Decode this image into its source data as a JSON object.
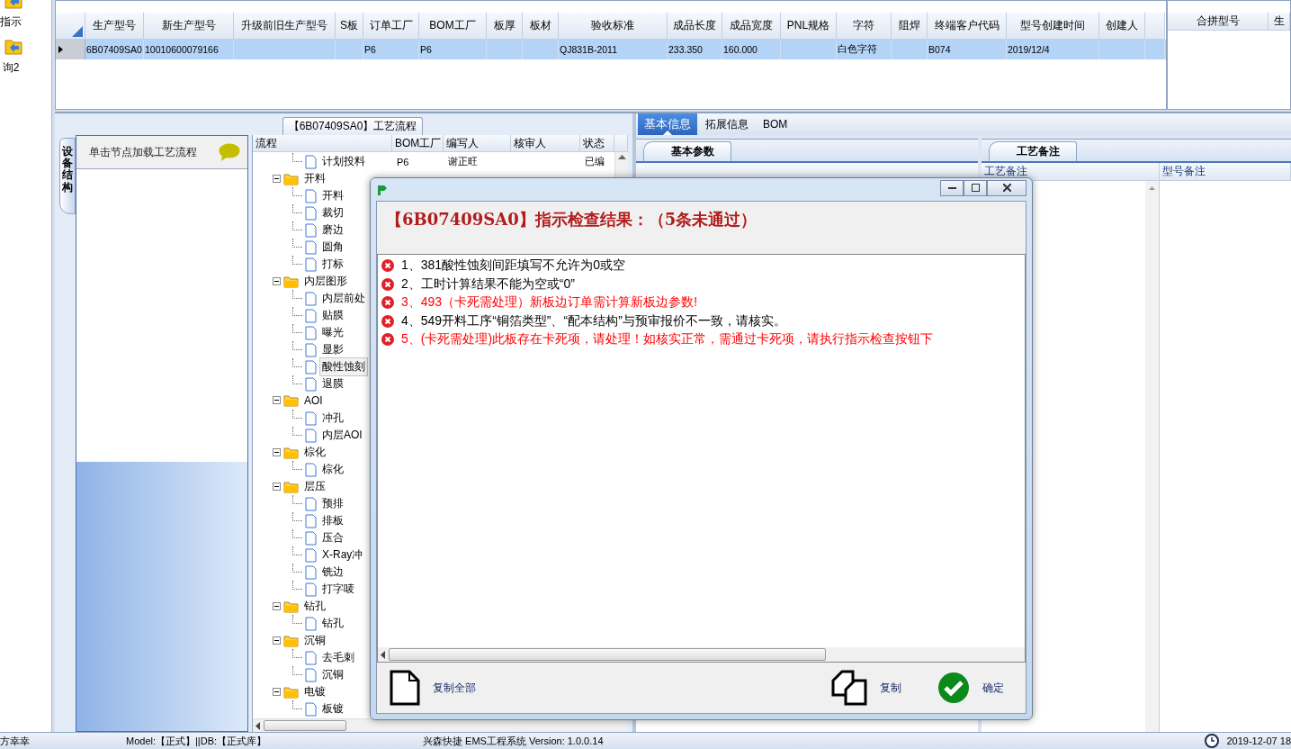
{
  "nav": {
    "items": [
      {
        "label": "指示"
      },
      {
        "label": "询2"
      }
    ]
  },
  "main_grid": {
    "columns": [
      "生产型号",
      "新生产型号",
      "升级前旧生产型号",
      "S板",
      "订单工厂",
      "BOM工厂",
      "板厚",
      "板材",
      "验收标准",
      "成品长度",
      "成品宽度",
      "PNL规格",
      "字符",
      "阻焊",
      "终端客户代码",
      "型号创建时间",
      "创建人"
    ],
    "rows": [
      {
        "selected": true,
        "cells": [
          "6B07409SA0",
          "10010600079166",
          null,
          null,
          "P6",
          "P6",
          null,
          null,
          "QJ831B-2011",
          "233.350",
          "160.000",
          null,
          "白色字符",
          null,
          "B074",
          "2019/12/4",
          null
        ]
      }
    ]
  },
  "side_grid": {
    "columns": [
      "合拼型号",
      "生"
    ]
  },
  "flow_panel": {
    "title": "【6B07409SA0】工艺流程"
  },
  "equipment": {
    "tab": "设备结构",
    "hint": "单击节点加载工艺流程"
  },
  "tree": {
    "columns": [
      "流程",
      "BOM工厂",
      "编写人",
      "核审人",
      "状态"
    ],
    "nodes": [
      {
        "kind": "leaf",
        "label": "计划投料",
        "selected": false,
        "cells": [
          "P6",
          "谢正旺",
          null,
          "已编"
        ]
      },
      {
        "kind": "folder",
        "label": "开料",
        "expanded": true,
        "children": [
          {
            "kind": "leaf",
            "label": "开料",
            "selected": false
          },
          {
            "kind": "leaf",
            "label": "裁切",
            "selected": false
          },
          {
            "kind": "leaf",
            "label": "磨边",
            "selected": false
          },
          {
            "kind": "leaf",
            "label": "圆角",
            "selected": false
          },
          {
            "kind": "leaf",
            "label": "打标",
            "selected": false
          }
        ]
      },
      {
        "kind": "folder",
        "label": "内层图形",
        "expanded": true,
        "children": [
          {
            "kind": "leaf",
            "label": "内层前处",
            "selected": false
          },
          {
            "kind": "leaf",
            "label": "贴膜",
            "selected": false
          },
          {
            "kind": "leaf",
            "label": "曝光",
            "selected": false
          },
          {
            "kind": "leaf",
            "label": "显影",
            "selected": false
          },
          {
            "kind": "leaf",
            "label": "酸性蚀刻",
            "selected": true
          },
          {
            "kind": "leaf",
            "label": "退膜",
            "selected": false
          }
        ]
      },
      {
        "kind": "folder",
        "label": "AOI",
        "expanded": true,
        "children": [
          {
            "kind": "leaf",
            "label": "冲孔",
            "selected": false
          },
          {
            "kind": "leaf",
            "label": "内层AOI",
            "selected": false
          }
        ]
      },
      {
        "kind": "folder",
        "label": "棕化",
        "expanded": true,
        "children": [
          {
            "kind": "leaf",
            "label": "棕化",
            "selected": false
          }
        ]
      },
      {
        "kind": "folder",
        "label": "层压",
        "expanded": true,
        "children": [
          {
            "kind": "leaf",
            "label": "预排",
            "selected": false
          },
          {
            "kind": "leaf",
            "label": "排板",
            "selected": false
          },
          {
            "kind": "leaf",
            "label": "压合",
            "selected": false
          },
          {
            "kind": "leaf",
            "label": "X-Ray冲",
            "selected": false
          },
          {
            "kind": "leaf",
            "label": "铣边",
            "selected": false
          },
          {
            "kind": "leaf",
            "label": "打字唛",
            "selected": false
          }
        ]
      },
      {
        "kind": "folder",
        "label": "钻孔",
        "expanded": true,
        "children": [
          {
            "kind": "leaf",
            "label": "钻孔",
            "selected": false
          }
        ]
      },
      {
        "kind": "folder",
        "label": "沉铜",
        "expanded": true,
        "children": [
          {
            "kind": "leaf",
            "label": "去毛刺",
            "selected": false
          },
          {
            "kind": "leaf",
            "label": "沉铜",
            "selected": false
          }
        ]
      },
      {
        "kind": "folder",
        "label": "电镀",
        "expanded": true,
        "children": [
          {
            "kind": "leaf",
            "label": "板镀",
            "selected": false
          }
        ]
      }
    ]
  },
  "detail_tabs": [
    {
      "label": "基本信息",
      "selected": true
    },
    {
      "label": "拓展信息",
      "selected": false
    },
    {
      "label": "BOM",
      "selected": false
    }
  ],
  "params": {
    "tab": "基本参数"
  },
  "notes": {
    "tab": "工艺备注",
    "columns": [
      "工艺备注",
      "型号备注"
    ]
  },
  "dialog": {
    "heading": "【6B07409SA0】指示检查结果：（5条未通过）",
    "items": [
      {
        "text": "1、381酸性蚀刻间距填写不允许为0或空",
        "color": "#000000"
      },
      {
        "text": "2、工时计算结果不能为空或“0”",
        "color": "#000000"
      },
      {
        "text": "3、493（卡死需处理）新板边订单需计算新板边参数!",
        "color": "#ff0000"
      },
      {
        "text": "4、549开料工序“铜箔类型”、“配本结构”与预审报价不一致，请核实。",
        "color": "#000000"
      },
      {
        "text": "5、(卡死需处理)此板存在卡死项，请处理！如核实正常，需通过卡死项，请执行指示检查按钮下",
        "color": "#ff0000"
      }
    ],
    "buttons": [
      {
        "kind": "copy_all",
        "label": "复制全部"
      },
      {
        "kind": "copy",
        "label": "复制"
      },
      {
        "kind": "ok",
        "label": "确定"
      }
    ]
  },
  "status_bar": {
    "user": "方幸幸",
    "env": "Model:【正式】||DB:【正式库】",
    "app": "兴森快捷 EMS工程系统 Version: 1.0.0.14",
    "time": "2019-12-07 18"
  }
}
